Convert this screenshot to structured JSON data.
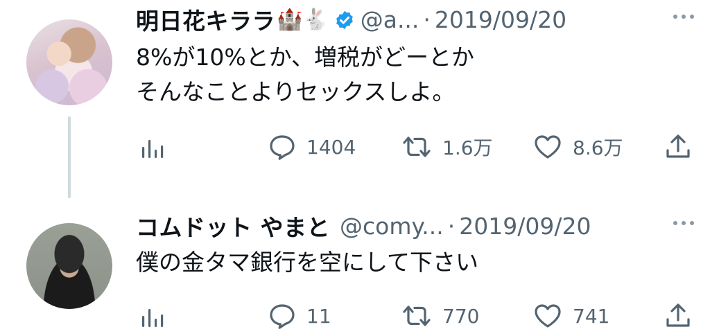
{
  "tweets": [
    {
      "display_name": "明日花キララ",
      "name_emoji": "🏰🐇",
      "verified": true,
      "handle": "@a...",
      "separator": "·",
      "date": "2019/09/20",
      "text_lines": [
        "8%が10%とか、増税がどーとか",
        "そんなことよりセックスしよ。"
      ],
      "replies": "1404",
      "retweets": "1.6万",
      "likes": "8.6万"
    },
    {
      "display_name": "コムドット やまと",
      "handle": "@comy...",
      "separator": "·",
      "date": "2019/09/20",
      "text_lines": [
        "僕の金タマ銀行を空にして下さい"
      ],
      "replies": "11",
      "retweets": "770",
      "likes": "741"
    }
  ],
  "icons": {
    "analytics": "analytics-icon",
    "reply": "reply-icon",
    "retweet": "retweet-icon",
    "like": "heart-icon",
    "share": "share-icon",
    "more": "more-icon",
    "verified": "verified-badge-icon"
  },
  "colors": {
    "text": "#0f1419",
    "muted": "#536471",
    "verified_blue": "#1d9bf0",
    "thread_line": "#cfd9de"
  }
}
